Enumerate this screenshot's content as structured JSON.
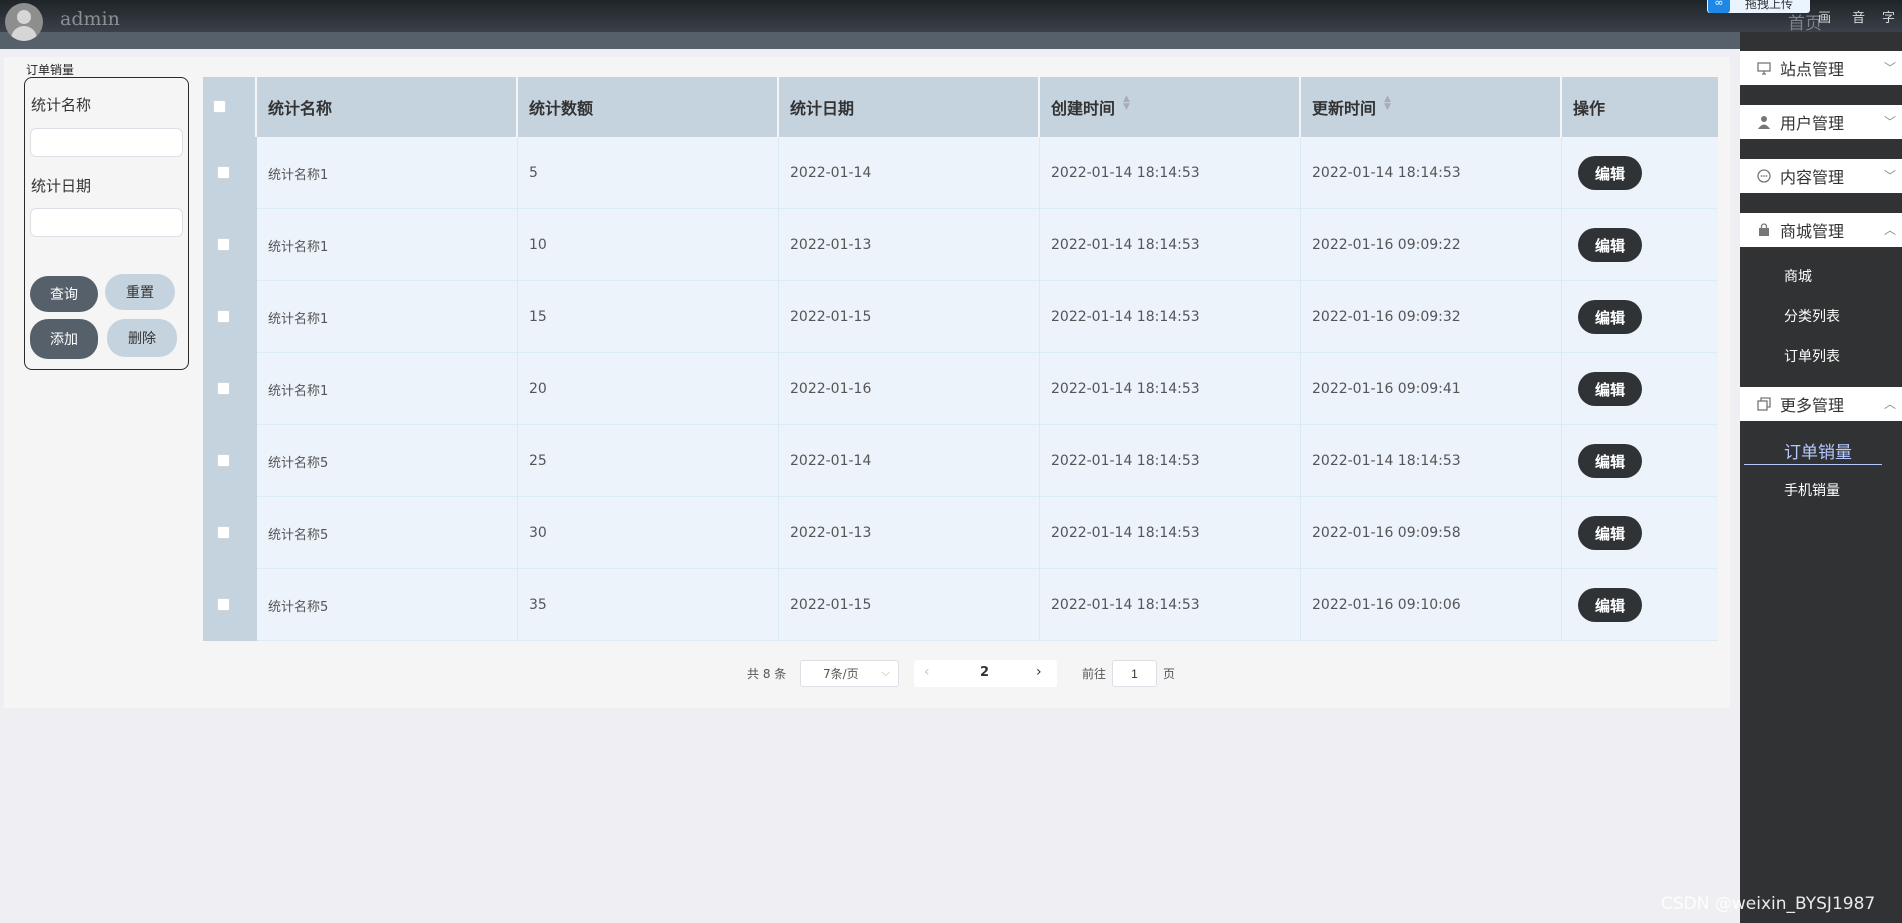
{
  "header": {
    "username": "admin",
    "upload_label": "拖拽上传",
    "home_label": "首页",
    "links": [
      "画",
      "音",
      "字"
    ]
  },
  "sidebar": {
    "menus": [
      {
        "label": "站点管理",
        "icon": "monitor-icon",
        "caret": "﹀"
      },
      {
        "label": "用户管理",
        "icon": "user-icon",
        "caret": "﹀"
      },
      {
        "label": "内容管理",
        "icon": "chat-icon",
        "caret": "﹀"
      },
      {
        "label": "商城管理",
        "icon": "shop-bag-icon",
        "caret": "︿"
      },
      {
        "label": "更多管理",
        "icon": "copy-icon",
        "caret": "︿"
      }
    ],
    "shop_items": [
      "商城",
      "分类列表",
      "订单列表"
    ],
    "more_items": [
      "订单销量",
      "手机销量"
    ],
    "active_item": "订单销量"
  },
  "panel": {
    "title": "订单销量"
  },
  "search": {
    "name_label": "统计名称",
    "name_value": "",
    "date_label": "统计日期",
    "date_value": "",
    "buttons": {
      "query": "查询",
      "reset": "重置",
      "add": "添加",
      "delete": "删除"
    }
  },
  "table": {
    "headers": [
      "统计名称",
      "统计数额",
      "统计日期",
      "创建时间",
      "更新时间",
      "操作"
    ],
    "sortable": [
      "创建时间",
      "更新时间"
    ],
    "edit_label": "编辑",
    "rows": [
      [
        "统计名称1",
        "5",
        "2022-01-14",
        "2022-01-14 18:14:53",
        "2022-01-14 18:14:53"
      ],
      [
        "统计名称1",
        "10",
        "2022-01-13",
        "2022-01-14 18:14:53",
        "2022-01-16 09:09:22"
      ],
      [
        "统计名称1",
        "15",
        "2022-01-15",
        "2022-01-14 18:14:53",
        "2022-01-16 09:09:32"
      ],
      [
        "统计名称1",
        "20",
        "2022-01-16",
        "2022-01-14 18:14:53",
        "2022-01-16 09:09:41"
      ],
      [
        "统计名称5",
        "25",
        "2022-01-14",
        "2022-01-14 18:14:53",
        "2022-01-14 18:14:53"
      ],
      [
        "统计名称5",
        "30",
        "2022-01-13",
        "2022-01-14 18:14:53",
        "2022-01-16 09:09:58"
      ],
      [
        "统计名称5",
        "35",
        "2022-01-15",
        "2022-01-14 18:14:53",
        "2022-01-16 09:10:06"
      ]
    ]
  },
  "pagination": {
    "total": "共 8 条",
    "page_size": "7条/页",
    "current_page": "2",
    "goto_label": "前往",
    "goto_value": "1",
    "page_unit": "页"
  },
  "watermark": "CSDN @weixin_BYSJ1987"
}
